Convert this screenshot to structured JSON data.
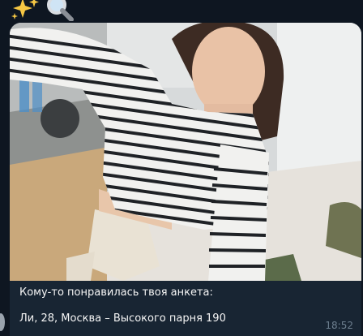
{
  "message": {
    "caption_line1": "Кому-то понравилась твоя анкета:",
    "caption_line2": "Ли, 28, Москва – Высокого парня 190",
    "time": "18:52"
  },
  "icons": {
    "sparkles": "sparkles-icon",
    "magnifier": "magnifying-glass-icon"
  }
}
